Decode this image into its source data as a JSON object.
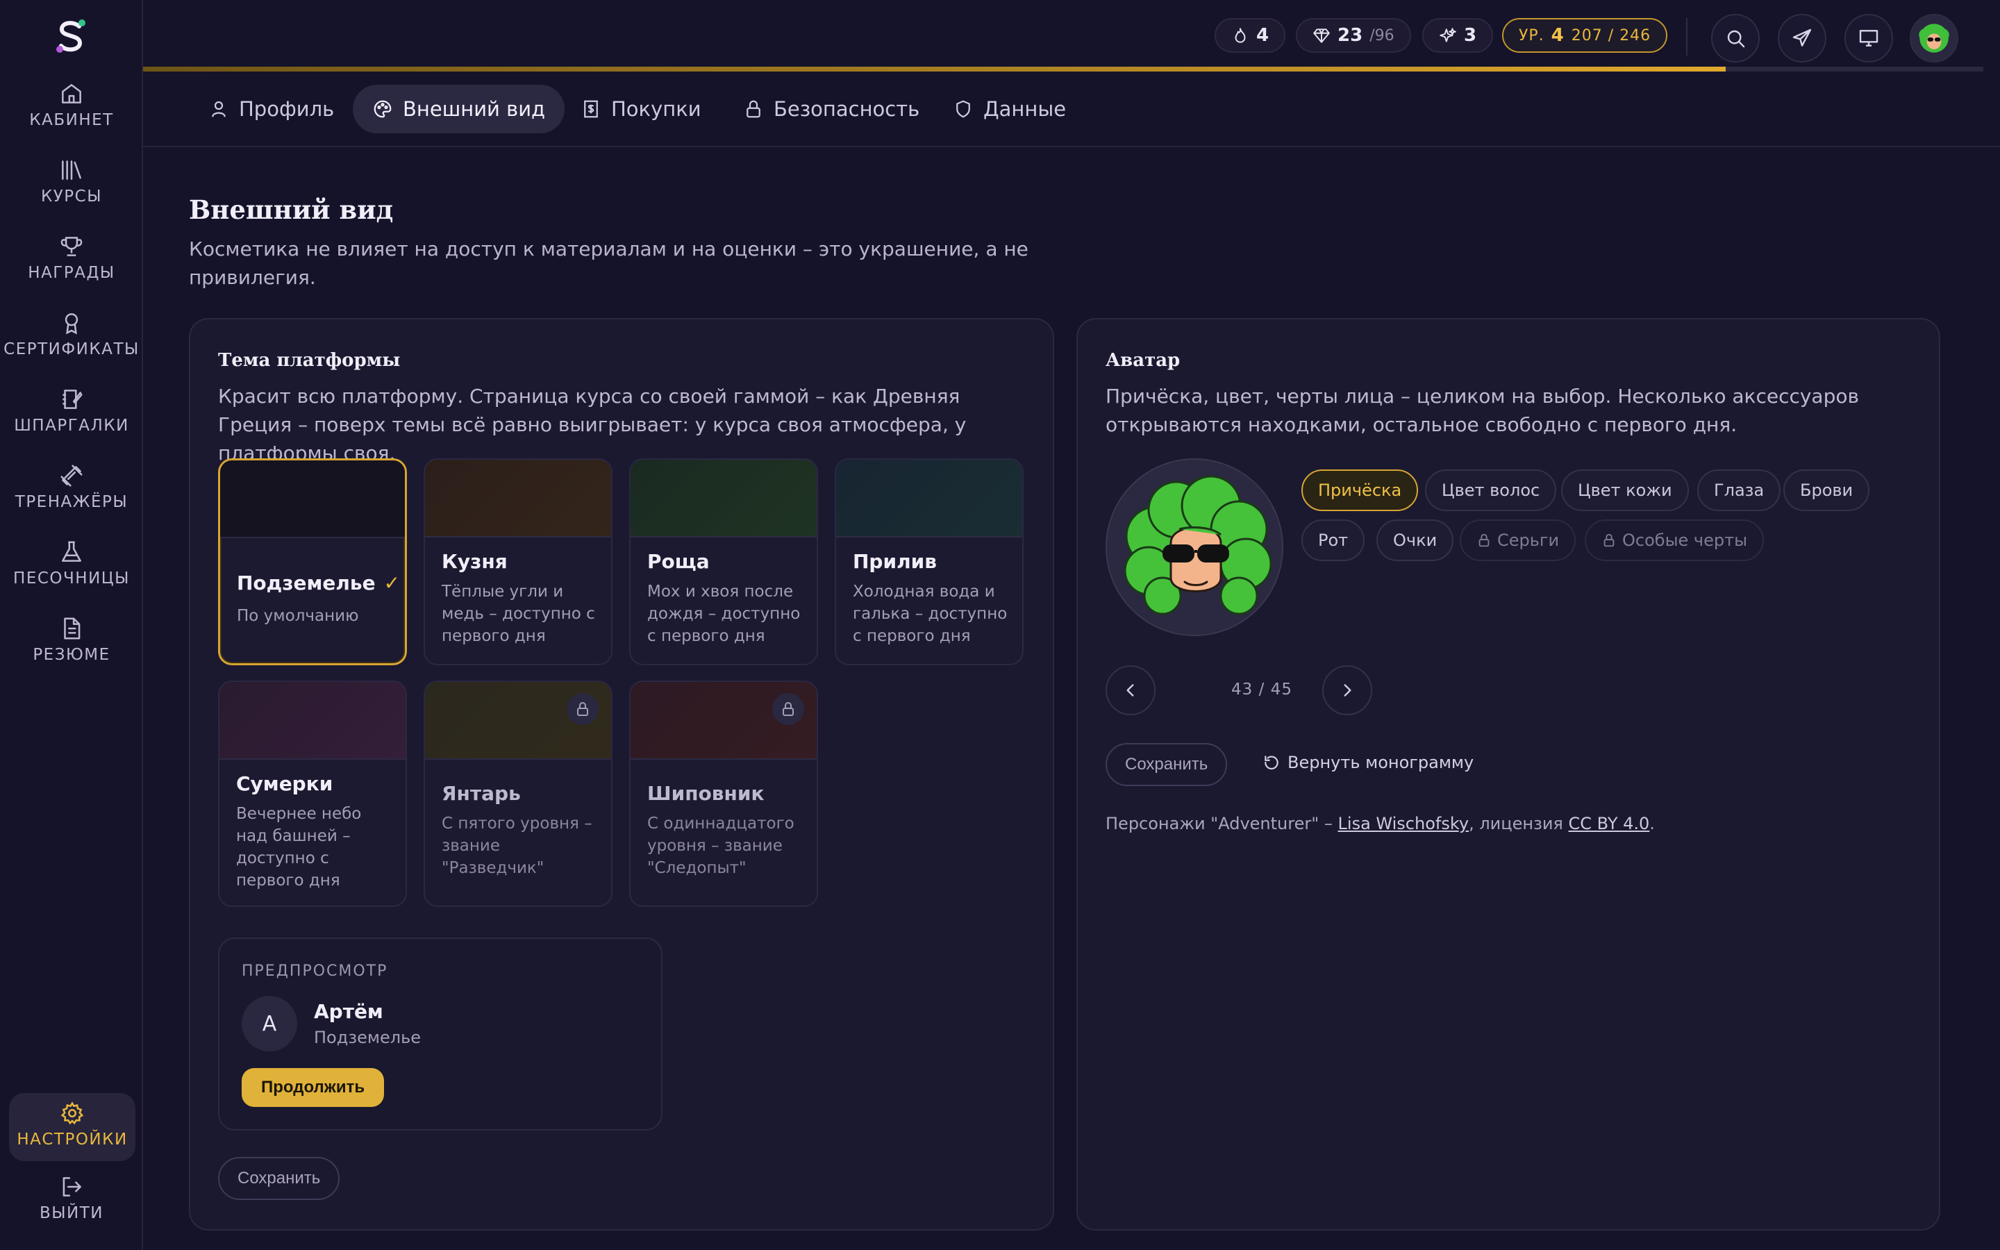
{
  "sidebar": {
    "items": [
      {
        "label": "КАБИНЕТ",
        "icon": "home-icon"
      },
      {
        "label": "КУРСЫ",
        "icon": "books-icon"
      },
      {
        "label": "НАГРАДЫ",
        "icon": "trophy-icon"
      },
      {
        "label": "СЕРТИФИКАТЫ",
        "icon": "ribbon-icon"
      },
      {
        "label": "ШПАРГАЛКИ",
        "icon": "notebook-icon"
      },
      {
        "label": "ТРЕНАЖЁРЫ",
        "icon": "dumbbell-icon"
      },
      {
        "label": "ПЕСОЧНИЦЫ",
        "icon": "flask-icon"
      },
      {
        "label": "РЕЗЮМЕ",
        "icon": "document-icon"
      }
    ],
    "settings_label": "НАСТРОЙКИ",
    "logout_label": "ВЫЙТИ"
  },
  "topbar": {
    "streak": "4",
    "gems": "23",
    "gems_total": "/96",
    "sparks": "3",
    "level_prefix": "УР.",
    "level": "4",
    "xp": "207 / 246",
    "xp_progress": 0.86
  },
  "tabs": [
    {
      "label": "Профиль"
    },
    {
      "label": "Внешний вид"
    },
    {
      "label": "Покупки"
    },
    {
      "label": "Безопасность"
    },
    {
      "label": "Данные"
    }
  ],
  "page": {
    "title": "Внешний вид",
    "description": "Косметика не влияет на доступ к материалам и на оценки – это украшение, а не привилегия."
  },
  "theme_card": {
    "title": "Тема платформы",
    "description": "Красит всю платформу. Страница курса со своей гаммой – как Древняя Греция – поверх темы всё равно выигрывает: у курса своя атмосфера, у платформы своя.",
    "themes": [
      {
        "name": "Подземелье",
        "desc": "По умолчанию"
      },
      {
        "name": "Кузня",
        "desc": "Тёплые угли и медь – доступно с первого дня"
      },
      {
        "name": "Роща",
        "desc": "Мох и хвоя после дождя – доступно с первого дня"
      },
      {
        "name": "Прилив",
        "desc": "Холодная вода и галька – доступно с первого дня"
      },
      {
        "name": "Сумерки",
        "desc": "Вечернее небо над башней – доступно с первого дня"
      },
      {
        "name": "Янтарь",
        "desc": "С пятого уровня – звание \"Разведчик\""
      },
      {
        "name": "Шиповник",
        "desc": "С одиннадцатого уровня – звание \"Следопыт\""
      }
    ],
    "colors": {
      "dungeon": "#15131f",
      "forge": "#2f2218",
      "grove": "#1b2a22",
      "tide": "#182833",
      "dusk": "#2c1c33",
      "amber": "#2e2a1e",
      "rosehip": "#2e1c24"
    },
    "preview": {
      "label": "ПРЕДПРОСМОТР",
      "initial": "А",
      "name": "Артём",
      "theme": "Подземелье",
      "button": "Продолжить"
    },
    "save_label": "Сохранить"
  },
  "avatar_card": {
    "title": "Аватар",
    "description": "Причёска, цвет, черты лица – целиком на выбор. Несколько аксессуаров открываются находками, остальное свободно с первого дня.",
    "chips": [
      {
        "label": "Причёска"
      },
      {
        "label": "Цвет волос"
      },
      {
        "label": "Цвет кожи"
      },
      {
        "label": "Глаза"
      },
      {
        "label": "Брови"
      },
      {
        "label": "Рот"
      },
      {
        "label": "Очки"
      },
      {
        "label": "Серьги"
      },
      {
        "label": "Особые черты"
      }
    ],
    "counter": "43 / 45",
    "save_label": "Сохранить",
    "reset_label": "Вернуть монограмму",
    "credits_prefix": "Персонажи \"Adventurer\" –",
    "credits_author": "Lisa Wischofsky",
    "credits_mid": ", лицензия",
    "credits_license": "CC BY 4.0",
    "credits_suffix": "."
  },
  "colors": {
    "accent": "#e0b23a",
    "background": "#15132a",
    "card": "#1b1930"
  }
}
